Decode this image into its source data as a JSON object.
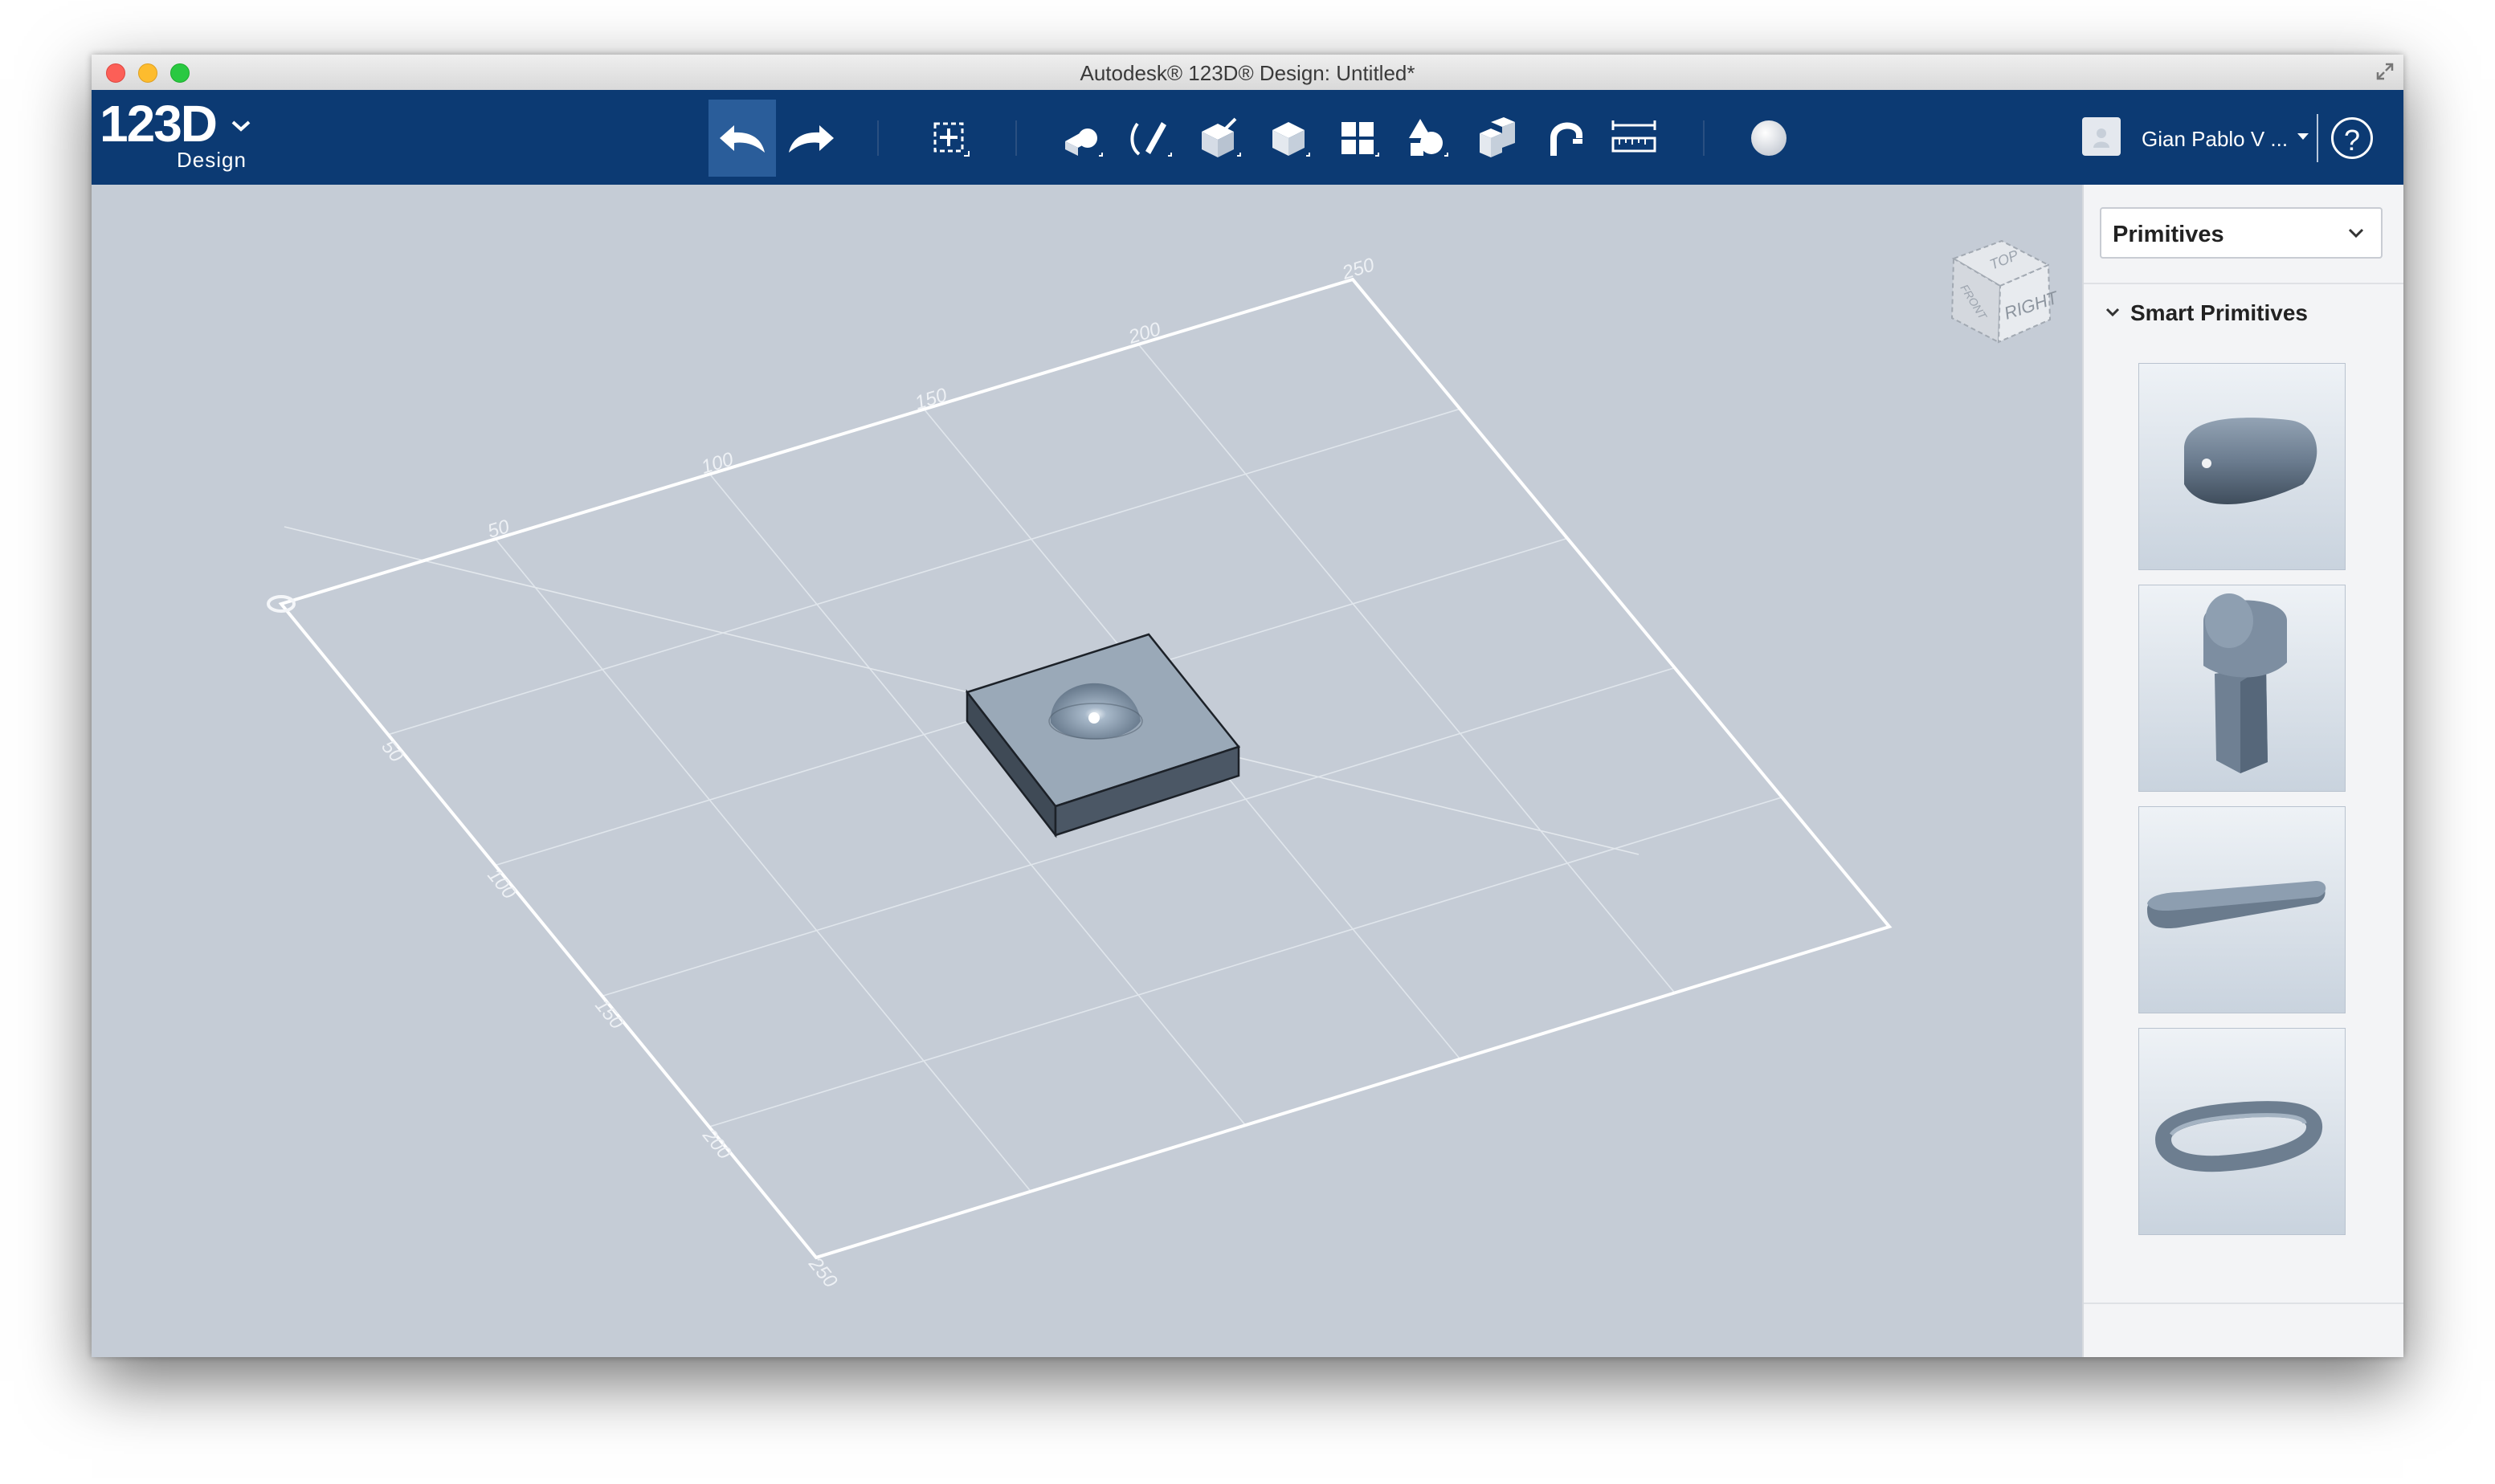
{
  "window": {
    "title": "Autodesk® 123D® Design: Untitled*"
  },
  "logo": {
    "main": "123D",
    "sub": "Design"
  },
  "toolbar": {
    "tools": [
      {
        "name": "undo",
        "active": true
      },
      {
        "name": "redo"
      },
      {
        "name": "transform"
      },
      {
        "name": "primitives"
      },
      {
        "name": "sketch"
      },
      {
        "name": "construct"
      },
      {
        "name": "modify"
      },
      {
        "name": "pattern"
      },
      {
        "name": "grouping"
      },
      {
        "name": "combine"
      },
      {
        "name": "snap"
      },
      {
        "name": "measure"
      },
      {
        "name": "material"
      }
    ]
  },
  "user": {
    "name": "Gian Pablo V ..."
  },
  "help": {
    "label": "?"
  },
  "viewcube": {
    "top": "TOP",
    "right": "RIGHT",
    "front": "FRONT"
  },
  "grid": {
    "top_edge_labels": [
      "50",
      "100",
      "150",
      "200",
      "250"
    ],
    "left_edge_labels": [
      "50",
      "100",
      "150",
      "200",
      "250"
    ]
  },
  "panel": {
    "dropdown_value": "Primitives",
    "section_title": "Smart Primitives",
    "items": [
      "capsule-primitive",
      "tab-primitive",
      "slot-primitive",
      "ring-primitive"
    ]
  },
  "colors": {
    "toolbar": "#0c3a73",
    "viewport": "#c5ccd6",
    "active_tool": "#2a5d9a"
  }
}
